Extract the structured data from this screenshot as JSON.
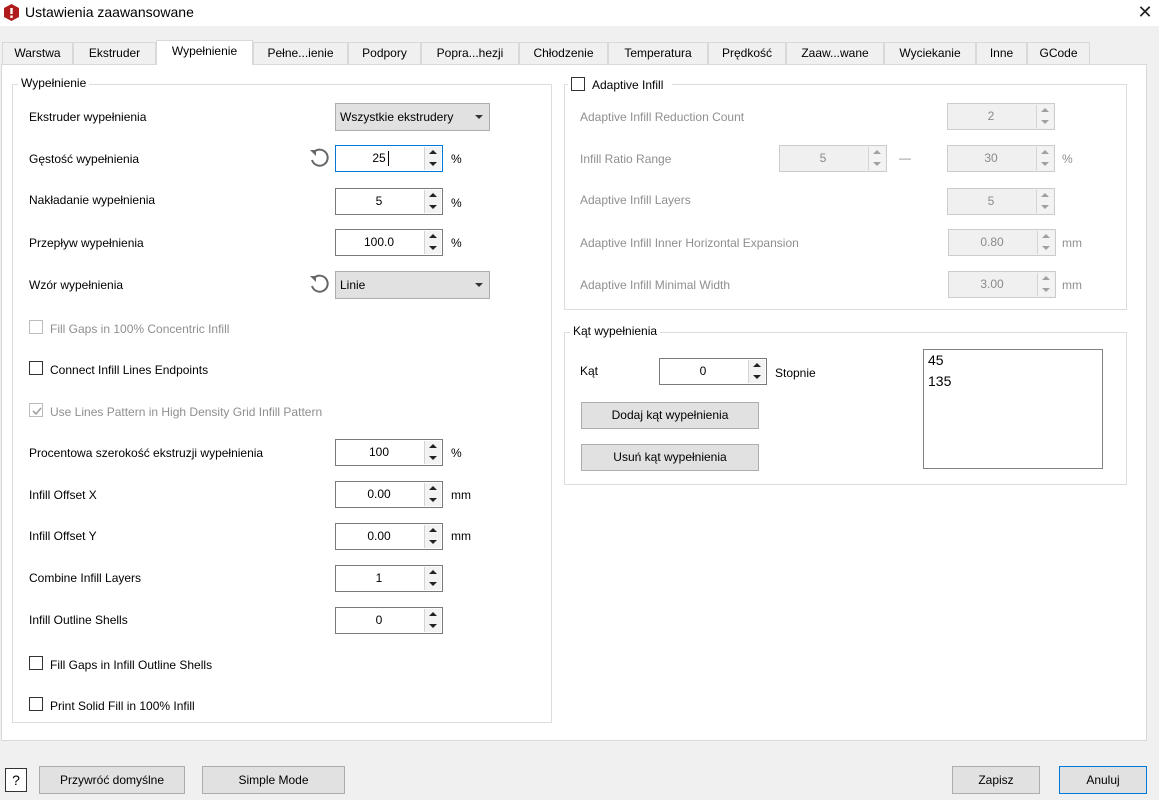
{
  "window": {
    "title": "Ustawienia zaawansowane",
    "close_label": "✕"
  },
  "tabs": [
    "Warstwa",
    "Ekstruder",
    "Wypełnienie",
    "Pełne...ienie",
    "Podpory",
    "Popra...hezji",
    "Chłodzenie",
    "Temperatura",
    "Prędkość",
    "Zaaw...wane",
    "Wyciekanie",
    "Inne",
    "GCode"
  ],
  "active_tab": "Wypełnienie",
  "infill": {
    "group_title": "Wypełnienie",
    "extruder_label": "Ekstruder wypełnienia",
    "extruder_value": "Wszystkie ekstrudery",
    "density_label": "Gęstość wypełnienia",
    "density_value": "25",
    "density_unit": "%",
    "overlap_label": "Nakładanie wypełnienia",
    "overlap_value": "5",
    "overlap_unit": "%",
    "flow_label": "Przepływ wypełnienia",
    "flow_value": "100.0",
    "flow_unit": "%",
    "pattern_label": "Wzór wypełnienia",
    "pattern_value": "Linie",
    "fill_gaps_concentric": "Fill Gaps in 100% Concentric Infill",
    "connect_endpoints": "Connect Infill Lines Endpoints",
    "use_lines_pattern": "Use Lines Pattern in High Density Grid Infill Pattern",
    "extrusion_width_label": "Procentowa szerokość ekstruzji wypełnienia",
    "extrusion_width_value": "100",
    "extrusion_width_unit": "%",
    "offset_x_label": "Infill Offset X",
    "offset_x_value": "0.00",
    "offset_x_unit": "mm",
    "offset_y_label": "Infill Offset Y",
    "offset_y_value": "0.00",
    "offset_y_unit": "mm",
    "combine_layers_label": "Combine Infill Layers",
    "combine_layers_value": "1",
    "outline_shells_label": "Infill Outline Shells",
    "outline_shells_value": "0",
    "fill_gaps_outline": "Fill Gaps in Infill Outline Shells",
    "print_solid_fill": "Print Solid Fill in 100% Infill"
  },
  "adaptive": {
    "group_title": "Adaptive Infill",
    "reduction_count_label": "Adaptive Infill Reduction Count",
    "reduction_count_value": "2",
    "ratio_range_label": "Infill Ratio Range",
    "ratio_min_value": "5",
    "ratio_dash": "—",
    "ratio_max_value": "30",
    "ratio_unit": "%",
    "layers_label": "Adaptive Infill Layers",
    "layers_value": "5",
    "inner_expansion_label": "Adaptive Infill Inner Horizontal Expansion",
    "inner_expansion_value": "0.80",
    "inner_expansion_unit": "mm",
    "min_width_label": "Adaptive Infill Minimal Width",
    "min_width_value": "3.00",
    "min_width_unit": "mm"
  },
  "angle": {
    "group_title": "Kąt wypełnienia",
    "angle_label": "Kąt",
    "angle_value": "0",
    "angle_unit": "Stopnie",
    "add_button": "Dodaj kąt wypełnienia",
    "remove_button": "Usuń kąt wypełnienia",
    "angles": [
      "45",
      "135"
    ]
  },
  "footer": {
    "help_label": "?",
    "restore_defaults": "Przywróć domyślne",
    "simple_mode": "Simple Mode",
    "save": "Zapisz",
    "cancel": "Anuluj"
  }
}
